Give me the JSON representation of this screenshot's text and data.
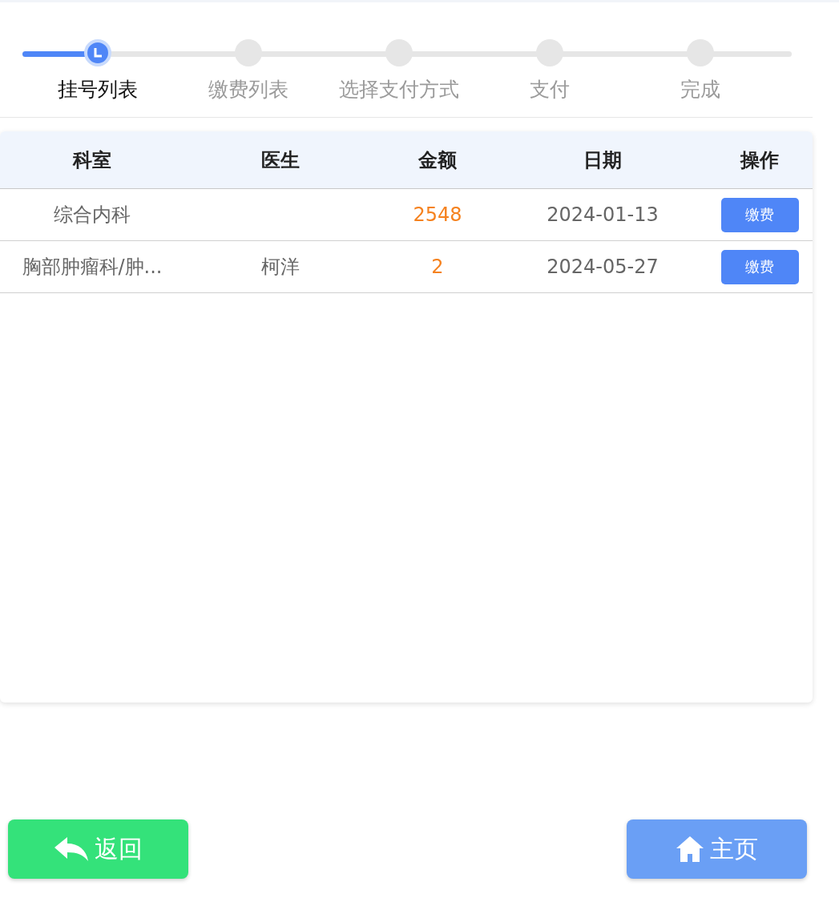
{
  "steps": [
    {
      "label": "挂号列表",
      "selected": true
    },
    {
      "label": "缴费列表",
      "selected": false
    },
    {
      "label": "选择支付方式",
      "selected": false
    },
    {
      "label": "支付",
      "selected": false
    },
    {
      "label": "完成",
      "selected": false
    }
  ],
  "table": {
    "columns": [
      "科室",
      "医生",
      "金额",
      "日期",
      "操作"
    ],
    "rows": [
      {
        "department": "综合内科",
        "amount": "2548",
        "date": "2024-01-13",
        "action": "缴费"
      },
      {
        "department": "胸部肿瘤科/肿...",
        "doctor": "柯洋",
        "amount": "2",
        "date": "2024-05-27",
        "action": "缴费"
      }
    ]
  },
  "buttons": [
    {
      "kind": "back",
      "label": "返回"
    },
    {
      "kind": "home",
      "label": "主页"
    }
  ]
}
